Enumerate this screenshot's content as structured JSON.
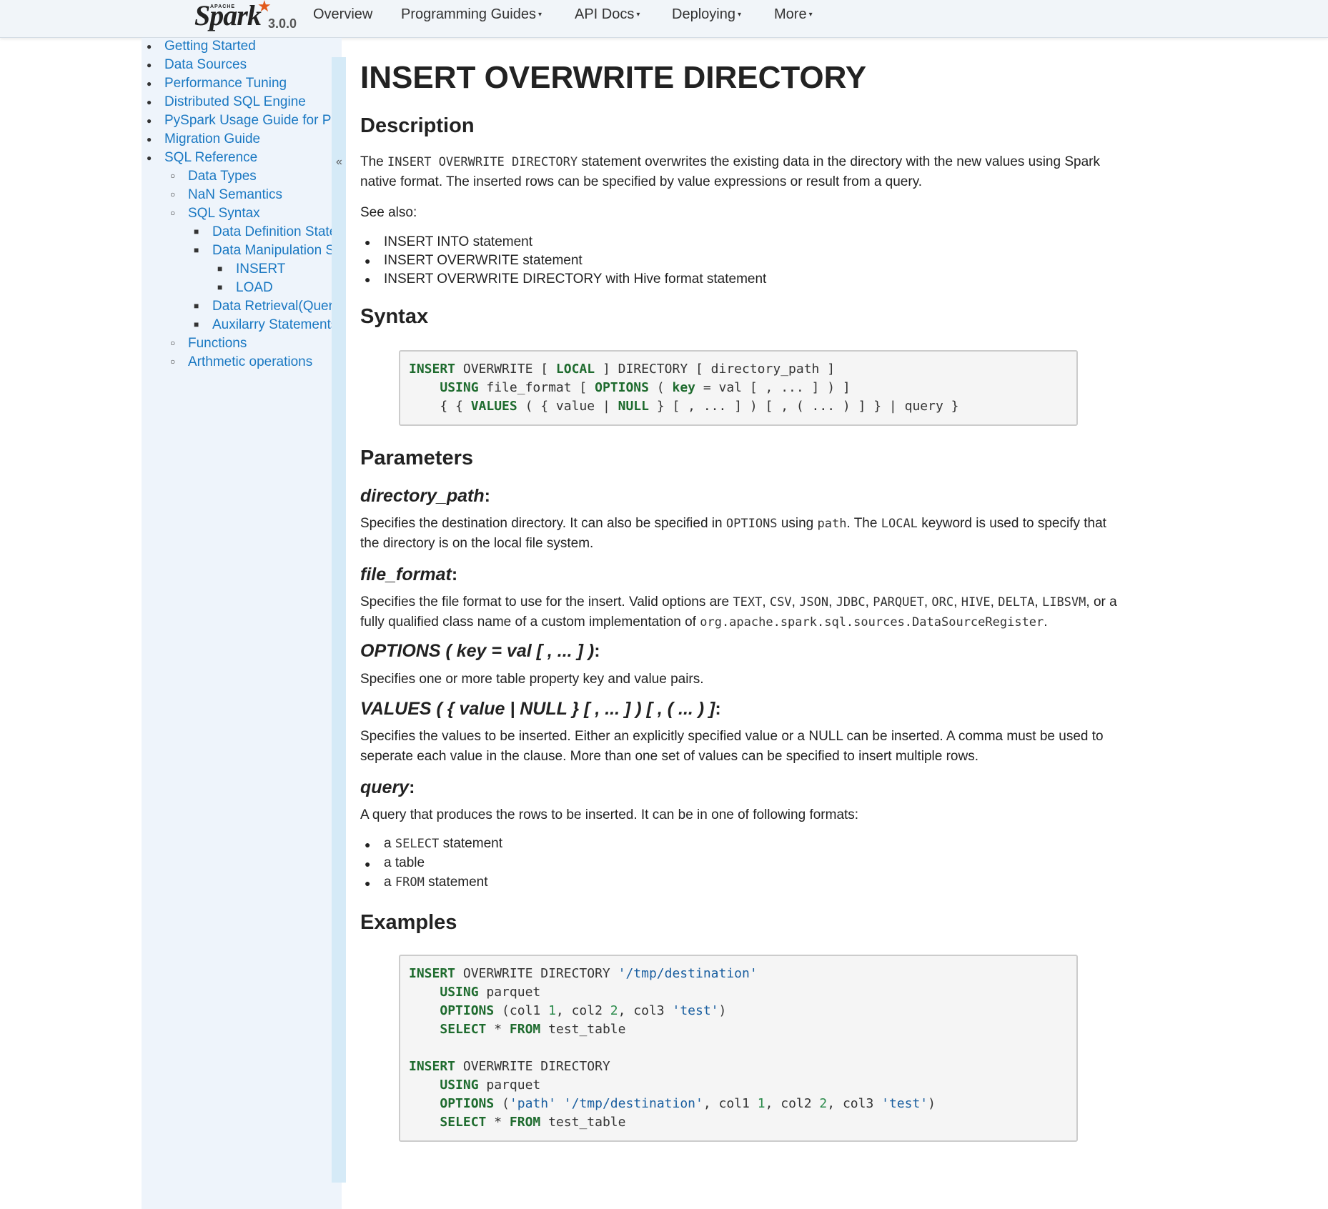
{
  "nav": {
    "brand_apache": "APACHE",
    "brand_logo": "Spark",
    "brand_version": "3.0.0",
    "items": [
      "Overview",
      "Programming Guides",
      "API Docs",
      "Deploying",
      "More"
    ]
  },
  "sidebar": {
    "collapse_glyph": "«",
    "items": [
      {
        "label": "Getting Started"
      },
      {
        "label": "Data Sources"
      },
      {
        "label": "Performance Tuning"
      },
      {
        "label": "Distributed SQL Engine"
      },
      {
        "label": "PySpark Usage Guide for Pa"
      },
      {
        "label": "Migration Guide"
      },
      {
        "label": "SQL Reference"
      },
      {
        "label": "Data Types"
      },
      {
        "label": "NaN Semantics"
      },
      {
        "label": "SQL Syntax"
      },
      {
        "label": "Data Definition State"
      },
      {
        "label": "Data Manipulation S"
      },
      {
        "label": "INSERT"
      },
      {
        "label": "LOAD"
      },
      {
        "label": "Data Retrieval(Queri"
      },
      {
        "label": "Auxilarry Statements"
      },
      {
        "label": "Functions"
      },
      {
        "label": "Arthmetic operations"
      }
    ]
  },
  "page": {
    "title": "INSERT OVERWRITE DIRECTORY",
    "description_heading": "Description",
    "description_p1": "The",
    "description_code": "INSERT OVERWRITE DIRECTORY",
    "description_p2": "statement overwrites the existing data in the directory with the new values using Spark native format. The inserted rows can be specified by value expressions or result from a query.",
    "see_also": "See also:",
    "see_also_links": [
      "INSERT INTO statement",
      "INSERT OVERWRITE statement",
      "INSERT OVERWRITE DIRECTORY with Hive format statement"
    ],
    "syntax_heading": "Syntax",
    "parameters_heading": "Parameters",
    "param_directory_path": "directory_path",
    "param_directory_path_colon": ":",
    "dp_text_1": "Specifies the destination directory. It can also be specified in",
    "dp_code_1": "OPTIONS",
    "dp_text_2": "using",
    "dp_code_2": "path",
    "dp_text_3": ". The",
    "dp_code_3": "LOCAL",
    "dp_text_4": "keyword is used to specify that the directory is on the local file system.",
    "param_file_format": "file_format",
    "param_file_format_colon": ":",
    "ff_text_1": "Specifies the file format to use for the insert. Valid options are",
    "ff_codes": [
      "TEXT",
      "CSV",
      "JSON",
      "JDBC",
      "PARQUET",
      "ORC",
      "HIVE",
      "DELTA",
      "LIBSVM"
    ],
    "ff_text_2": ", or a fully qualified class name of a custom implementation of",
    "ff_code_last": "org.apache.spark.sql.sources.DataSourceRegister",
    "ff_text_3": ".",
    "param_options": "OPTIONS ( key = val [ , ... ] )",
    "param_options_colon": ":",
    "options_text": "Specifies one or more table property key and value pairs.",
    "param_values": "VALUES ( { value | NULL } [ , ... ] ) [ , ( ... ) ]",
    "param_values_colon": ":",
    "values_text": "Specifies the values to be inserted. Either an explicitly specified value or a NULL can be inserted. A comma must be used to seperate each value in the clause. More than one set of values can be specified to insert multiple rows.",
    "param_query": "query",
    "param_query_colon": ":",
    "query_text": "A query that produces the rows to be inserted. It can be in one of following formats:",
    "query_item1_a": "a",
    "query_item1_code": "SELECT",
    "query_item1_b": "statement",
    "query_item2": "a table",
    "query_item3_a": "a",
    "query_item3_code": "FROM",
    "query_item3_b": "statement",
    "examples_heading": "Examples"
  },
  "syntax_code": {
    "l1": [
      [
        "kw",
        "INSERT"
      ],
      [
        "t",
        " OVERWRITE [ "
      ],
      [
        "kw",
        "LOCAL"
      ],
      [
        "t",
        " ] DIRECTORY [ directory_path ]"
      ]
    ],
    "l2": [
      [
        "t",
        "    "
      ],
      [
        "kw",
        "USING"
      ],
      [
        "t",
        " file_format [ "
      ],
      [
        "kw",
        "OPTIONS"
      ],
      [
        "t",
        " ( "
      ],
      [
        "kw",
        "key"
      ],
      [
        "t",
        " = val [ , ... ] ) ]"
      ]
    ],
    "l3": [
      [
        "t",
        "    { { "
      ],
      [
        "kw",
        "VALUES"
      ],
      [
        "t",
        " ( { value | "
      ],
      [
        "kw",
        "NULL"
      ],
      [
        "t",
        " } [ , ... ] ) [ , ( ... ) ] } | query }"
      ]
    ]
  },
  "example_code": {
    "l1": [
      [
        "kw",
        "INSERT"
      ],
      [
        "t",
        " OVERWRITE DIRECTORY "
      ],
      [
        "str",
        "'/tmp/destination'"
      ]
    ],
    "l2": [
      [
        "t",
        "    "
      ],
      [
        "kw",
        "USING"
      ],
      [
        "t",
        " parquet"
      ]
    ],
    "l3": [
      [
        "t",
        "    "
      ],
      [
        "kw",
        "OPTIONS"
      ],
      [
        "t",
        " (col1 "
      ],
      [
        "num",
        "1"
      ],
      [
        "t",
        ", col2 "
      ],
      [
        "num",
        "2"
      ],
      [
        "t",
        ", col3 "
      ],
      [
        "str",
        "'test'"
      ],
      [
        "t",
        ")"
      ]
    ],
    "l4": [
      [
        "t",
        "    "
      ],
      [
        "kw",
        "SELECT"
      ],
      [
        "t",
        " * "
      ],
      [
        "kw",
        "FROM"
      ],
      [
        "t",
        " test_table"
      ]
    ],
    "l5": [
      [
        "t",
        " "
      ]
    ],
    "l6": [
      [
        "kw",
        "INSERT"
      ],
      [
        "t",
        " OVERWRITE DIRECTORY"
      ]
    ],
    "l7": [
      [
        "t",
        "    "
      ],
      [
        "kw",
        "USING"
      ],
      [
        "t",
        " parquet"
      ]
    ],
    "l8": [
      [
        "t",
        "    "
      ],
      [
        "kw",
        "OPTIONS"
      ],
      [
        "t",
        " ("
      ],
      [
        "str",
        "'path'"
      ],
      [
        "t",
        " "
      ],
      [
        "str",
        "'/tmp/destination'"
      ],
      [
        "t",
        ", col1 "
      ],
      [
        "num",
        "1"
      ],
      [
        "t",
        ", col2 "
      ],
      [
        "num",
        "2"
      ],
      [
        "t",
        ", col3 "
      ],
      [
        "str",
        "'test'"
      ],
      [
        "t",
        ")"
      ]
    ],
    "l9": [
      [
        "t",
        "    "
      ],
      [
        "kw",
        "SELECT"
      ],
      [
        "t",
        " * "
      ],
      [
        "kw",
        "FROM"
      ],
      [
        "t",
        " test_table"
      ]
    ]
  },
  "colors": {
    "link": "#1a78c2",
    "keyword": "#1e6b2e",
    "string": "#1a5fa0",
    "number": "#2a8a4a",
    "sidebar_bg": "#eef4fb",
    "nav_bg": "#f1f5f9"
  }
}
